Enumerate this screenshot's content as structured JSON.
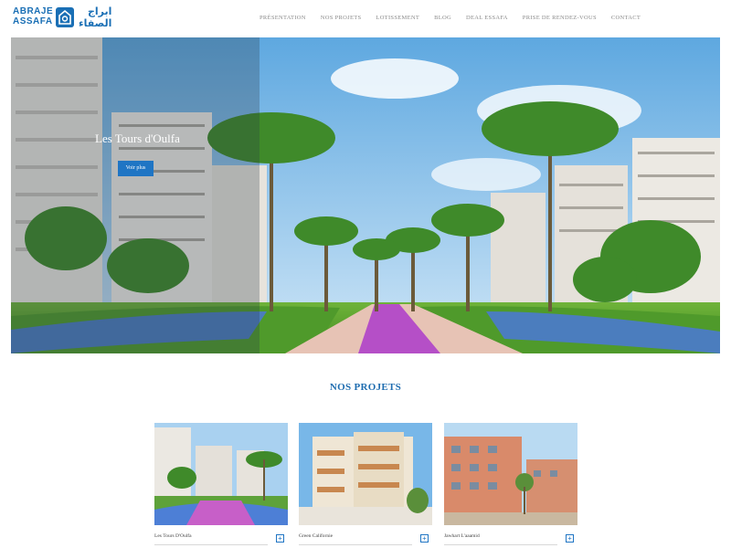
{
  "brand": {
    "name_line1": "ABRAJE",
    "name_line2": "ASSAFA",
    "arabic_line1": "ابراج",
    "arabic_line2": "الصفاء",
    "color": "#1a6fb5"
  },
  "nav": {
    "items": [
      "PRÉSENTATION",
      "NOS PROJETS",
      "LOTISSEMENT",
      "BLOG",
      "DEAL ESSAFA",
      "PRISE DE RENDEZ-VOUS",
      "CONTACT"
    ]
  },
  "hero": {
    "title": "Les Tours d'Oulfa",
    "button_label": "Voir plus"
  },
  "projects": {
    "title": "NOS PROJETS",
    "cards": [
      {
        "name": "Les Tours D'Oulfa",
        "icon": "plus-icon"
      },
      {
        "name": "Green Californie",
        "icon": "plus-icon"
      },
      {
        "name": "Jawhart L'aaamid",
        "icon": "plus-icon"
      }
    ],
    "accent": "#1f75c4"
  }
}
